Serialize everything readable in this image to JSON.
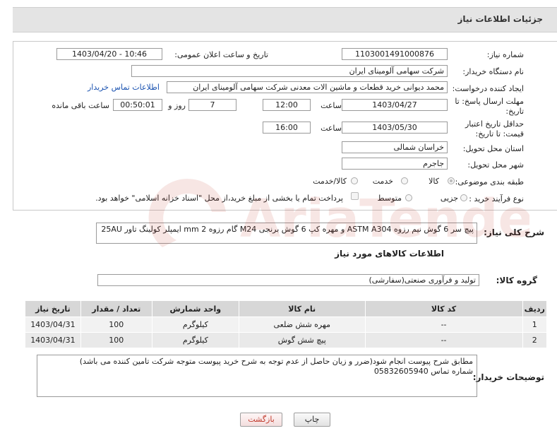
{
  "header": {
    "title": "جزئیات اطلاعات نیاز"
  },
  "need": {
    "number_label": "شماره نیاز:",
    "number": "1103001491000876",
    "announce_label": "تاریخ و ساعت اعلان عمومی:",
    "announce": "1403/04/20 - 10:46",
    "buyer_label": "نام دستگاه خریدار:",
    "buyer": "شرکت سهامی آلومینای ایران",
    "creator_label": "ایجاد کننده درخواست:",
    "creator": "محمد دیوانی خرید قطعات و ماشین الات معدنی شرکت سهامی آلومینای ایران",
    "contact_link": "اطلاعات تماس خریدار",
    "deadline_label": "مهلت ارسال پاسخ: تا تاریخ:",
    "deadline_date": "1403/04/27",
    "time_label": "ساعت",
    "deadline_time": "12:00",
    "days": "7",
    "days_label": "روز و",
    "remaining": "00:50:01",
    "remaining_label": "ساعت باقی مانده",
    "validity_label": "حداقل تاریخ اعتبار قیمت: تا تاریخ:",
    "validity_date": "1403/05/30",
    "validity_time": "16:00",
    "province_label": "استان محل تحویل:",
    "province": "خراسان شمالی",
    "city_label": "شهر محل تحویل:",
    "city": "جاجرم",
    "category_label": "طبقه بندی موضوعی:",
    "category_options": [
      "کالا",
      "خدمت",
      "کالا/خدمت"
    ],
    "process_label": "نوع فرآیند خرید :",
    "process_options": [
      "جزیی",
      "متوسط"
    ],
    "payment_note": "پرداخت تمام یا بخشی از مبلغ خرید،از محل \"اسناد خزانه اسلامی\" خواهد بود."
  },
  "summary": {
    "label": "شرح کلی نیاز:",
    "text": "پیچ سر 6 گوش نیم رزوه ASTM A304 و مهره کپ 6 گوش برنجی M24 گام رزوه 2 mm ایمپلر کولینگ تاور 25AU"
  },
  "goods": {
    "section_title": "اطلاعات کالاهای مورد نیاز",
    "group_label": "گروه کالا:",
    "group": "تولید و فرآوری صنعتی(سفارشی)",
    "columns": [
      "ردیف",
      "کد کالا",
      "نام کالا",
      "واحد شمارش",
      "تعداد / مقدار",
      "تاریخ نیاز"
    ],
    "rows": [
      {
        "idx": "1",
        "code": "--",
        "name": "مهره شش ضلعی",
        "unit": "کیلوگرم",
        "qty": "100",
        "date": "1403/04/31"
      },
      {
        "idx": "2",
        "code": "--",
        "name": "پیچ شش گوش",
        "unit": "کیلوگرم",
        "qty": "100",
        "date": "1403/04/31"
      }
    ]
  },
  "buyer_notes": {
    "label": "توضیحات خریدار:",
    "line1": "مطابق شرح پیوست انجام شود(ضرر و زیان حاصل از عدم توجه به شرح خرید پیوست متوجه شرکت تامین کننده می باشد)",
    "line2": "شماره تماس 05832605940"
  },
  "buttons": {
    "print": "چاپ",
    "back": "بازگشت"
  },
  "watermark": {
    "text": "AriaTender.neT"
  },
  "colors": {
    "link": "#1a52b0",
    "back_button_text": "#c0392b",
    "header_bg": "#e4e4e4"
  }
}
